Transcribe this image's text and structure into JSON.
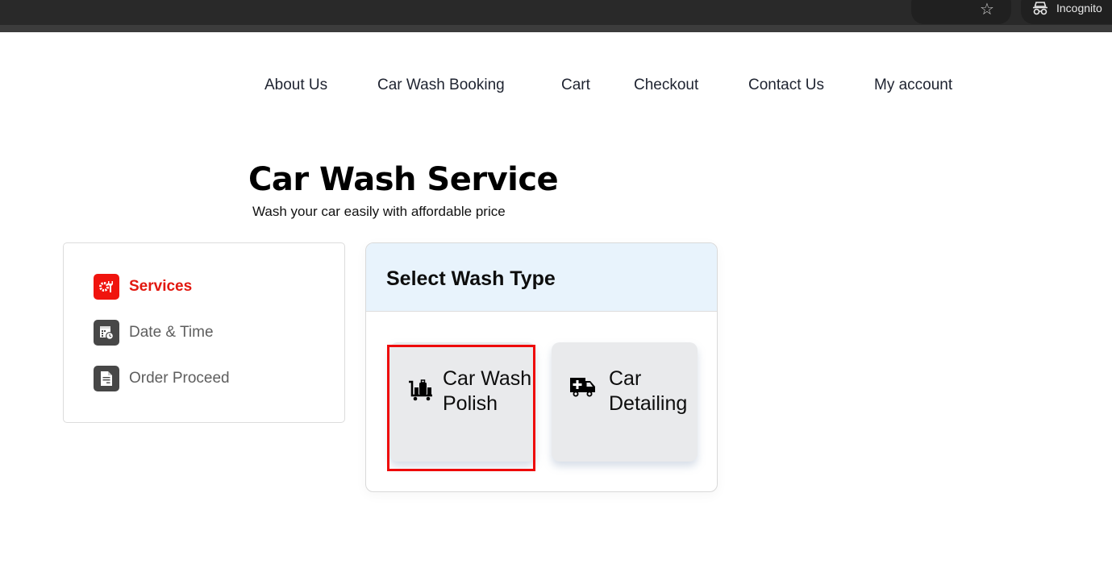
{
  "browser": {
    "bookmark_icon": "star-icon",
    "profile_icon": "incognito-icon",
    "profile_label": "Incognito"
  },
  "nav": {
    "items": [
      {
        "label": "About Us"
      },
      {
        "label": "Car Wash Booking"
      },
      {
        "label": "Cart"
      },
      {
        "label": "Checkout"
      },
      {
        "label": "Contact Us"
      },
      {
        "label": "My account"
      }
    ]
  },
  "hero": {
    "title": "Car Wash Service",
    "subtitle": "Wash your car easily with affordable price"
  },
  "steps": {
    "items": [
      {
        "label": "Services",
        "icon": "tools-gear-icon",
        "active": true
      },
      {
        "label": "Date & Time",
        "icon": "calendar-clock-icon",
        "active": false
      },
      {
        "label": "Order Proceed",
        "icon": "document-icon",
        "active": false
      }
    ]
  },
  "wash_type": {
    "title": "Select Wash Type",
    "options": [
      {
        "label": "Car Wash Polish",
        "icon": "luggage-cart-icon",
        "selected": true
      },
      {
        "label": "Car Detailing",
        "icon": "ambulance-truck-icon",
        "selected": false
      }
    ]
  },
  "colors": {
    "accent_red": "#f0140e",
    "panel_header_bg": "#e8f3fc",
    "option_bg": "#e9eaec",
    "step_icon_bg": "#474747"
  }
}
